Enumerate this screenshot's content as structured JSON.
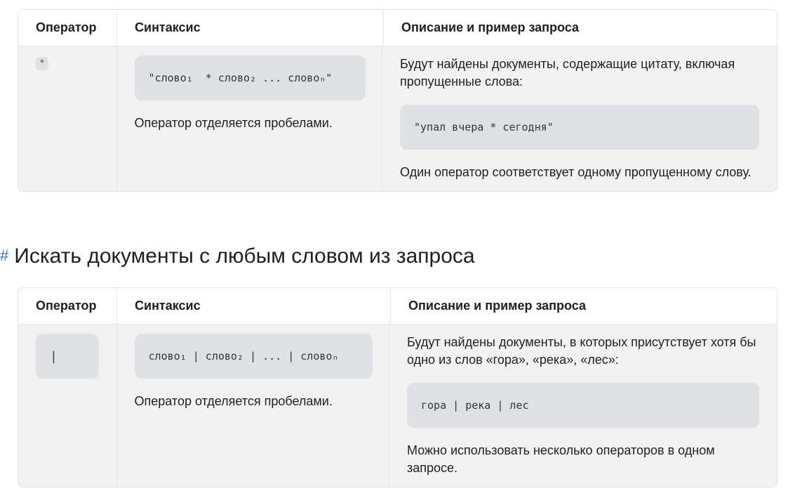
{
  "table1": {
    "headers": [
      "Оператор",
      "Синтаксис",
      "Описание и пример запроса"
    ],
    "operator": "*",
    "syntax": "\"слово₁  * слово₂ ... словоₙ\"",
    "syntax_note": "Оператор отделяется пробелами.",
    "description": "Будут найдены документы, содержащие цитату, включая пропущенные слова:",
    "example": "\"упал вчера * сегодня\"",
    "note": "Один оператор соответствует одному пропущенному слову."
  },
  "section": {
    "anchor": "#",
    "title": "Искать документы с любым словом из запроса"
  },
  "table2": {
    "headers": [
      "Оператор",
      "Синтаксис",
      "Описание и пример запроса"
    ],
    "operator": "|",
    "syntax": "слово₁ | слово₂ | ... | словоₙ",
    "syntax_note": "Оператор отделяется пробелами.",
    "description": "Будут найдены документы, в которых присутствует хотя бы одно из слов «гора», «река», «лес»:",
    "example": "гора | река | лес",
    "note": "Можно использовать несколько операторов в одном запросе."
  }
}
